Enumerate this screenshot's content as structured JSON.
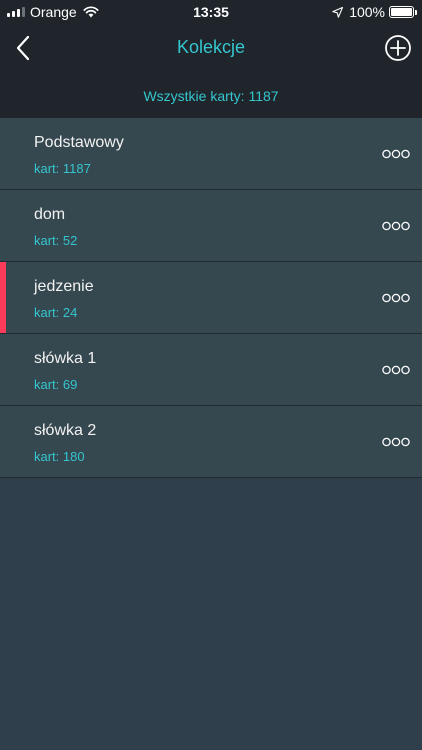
{
  "status_bar": {
    "carrier": "Orange",
    "time": "13:35",
    "battery": "100%"
  },
  "nav": {
    "title": "Kolekcje",
    "back_icon": "chevron-left-icon",
    "add_icon": "plus-circle-icon"
  },
  "summary": "Wszystkie karty: 1187",
  "colors": {
    "accent": "#35c6cf",
    "highlight": "#ff3b5c",
    "header_bg": "#1f252b",
    "row_bg": "#35474f"
  },
  "collections": [
    {
      "name": "Podstawowy",
      "count": "kart: 1187",
      "highlighted": false
    },
    {
      "name": "dom",
      "count": "kart: 52",
      "highlighted": false
    },
    {
      "name": "jedzenie",
      "count": "kart: 24",
      "highlighted": true
    },
    {
      "name": "słówka 1",
      "count": "kart: 69",
      "highlighted": false
    },
    {
      "name": "słówka 2",
      "count": "kart: 180",
      "highlighted": false
    }
  ]
}
